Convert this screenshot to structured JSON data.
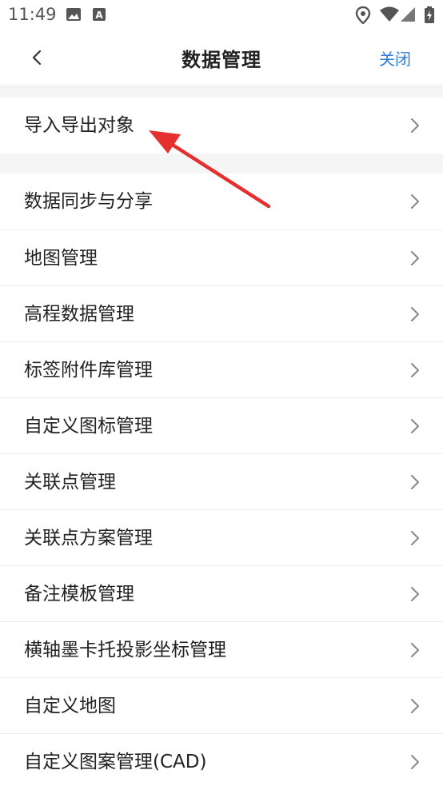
{
  "status_bar": {
    "time": "11:49",
    "left_icons": [
      "image-icon",
      "app-a-icon"
    ],
    "right_icons": [
      "location-icon",
      "wifi-icon",
      "signal-icon",
      "battery-icon"
    ]
  },
  "header": {
    "title": "数据管理",
    "back_icon": "chevron-left-icon",
    "close_label": "关闭"
  },
  "colors": {
    "accent": "#2f7de1",
    "section_gap": "#f5f5f6",
    "annotation_arrow": "#e53030"
  },
  "sections": [
    {
      "items": [
        {
          "label": "导入导出对象"
        }
      ]
    },
    {
      "items": [
        {
          "label": "数据同步与分享"
        },
        {
          "label": "地图管理"
        },
        {
          "label": "高程数据管理"
        },
        {
          "label": "标签附件库管理"
        },
        {
          "label": "自定义图标管理"
        },
        {
          "label": "关联点管理"
        },
        {
          "label": "关联点方案管理"
        },
        {
          "label": "备注模板管理"
        },
        {
          "label": "横轴墨卡托投影坐标管理"
        },
        {
          "label": "自定义地图"
        },
        {
          "label": "自定义图案管理(CAD)"
        }
      ]
    }
  ]
}
